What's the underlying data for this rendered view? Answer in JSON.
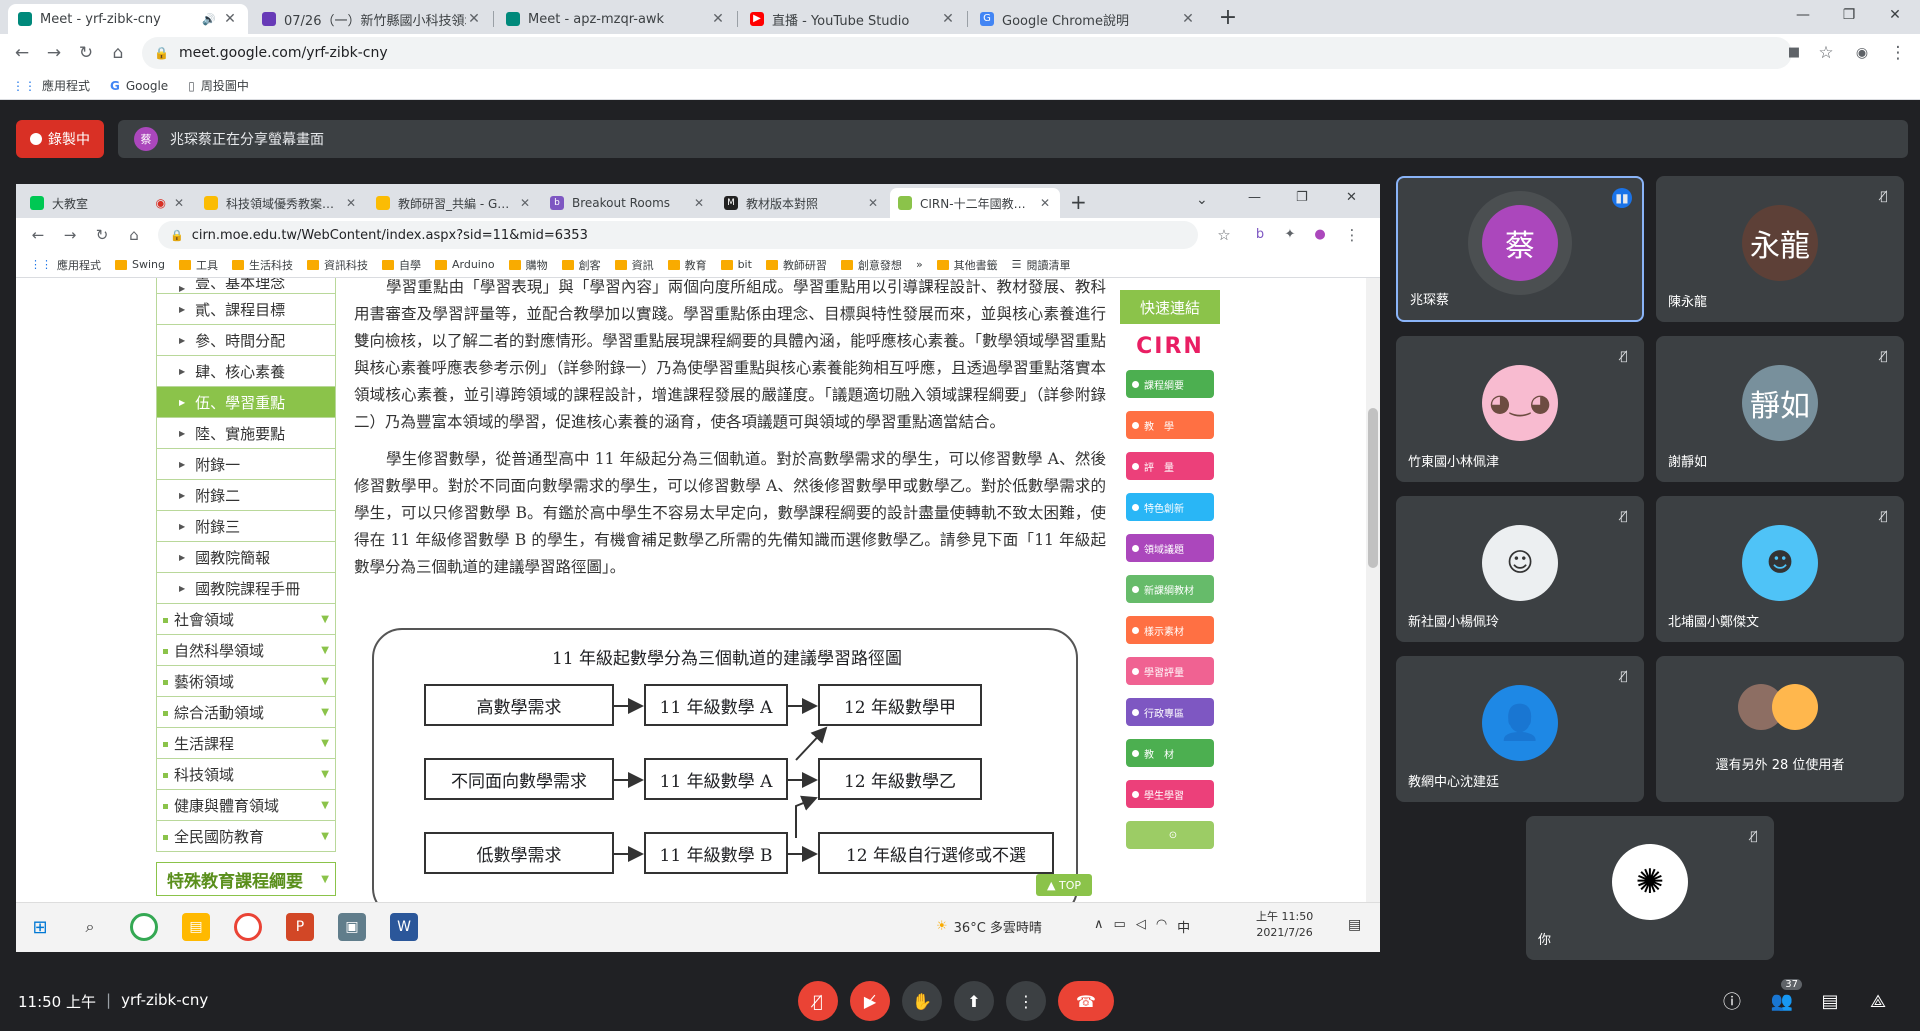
{
  "browser": {
    "tabs": [
      {
        "title": "Meet - yrf-zibk-cny",
        "color": "#00897b"
      },
      {
        "title": "07/26（一）新竹縣國小科技領域…",
        "color": "#673ab7"
      },
      {
        "title": "Meet - apz-mzqr-awk",
        "color": "#00897b"
      },
      {
        "title": "直播 - YouTube Studio",
        "color": "#ff0000"
      },
      {
        "title": "Google Chrome說明",
        "color": "#4285f4"
      }
    ],
    "url": "meet.google.com/yrf-zibk-cny",
    "bookmarks": [
      "應用程式",
      "Google",
      "周投圖中"
    ]
  },
  "meet": {
    "recording_label": "錄製中",
    "presenter_initial": "蔡",
    "presenting_text": "兆琛蔡正在分享螢幕畫面",
    "time": "11:50 上午",
    "meeting_code": "yrf-zibk-cny",
    "participant_count": "37"
  },
  "shared": {
    "tabs": [
      "大教室",
      "科技領域優秀教案…",
      "教師研習_共編 - G…",
      "Breakout Rooms",
      "教材版本對照",
      "CIRN-十二年國教…"
    ],
    "url": "cirn.moe.edu.tw/WebContent/index.aspx?sid=11&mid=6353",
    "bookmarks": [
      "應用程式",
      "Swing",
      "工具",
      "生活科技",
      "資訊科技",
      "自學",
      "Arduino",
      "購物",
      "創客",
      "資訊",
      "教育",
      "bit",
      "教師研習",
      "創意發想",
      "»",
      "其他書籤",
      "閱讀清單"
    ],
    "nav_items": [
      "壹、基本理念",
      "貳、課程目標",
      "參、時間分配",
      "肆、核心素養",
      "伍、學習重點",
      "陸、實施要點",
      "附錄一",
      "附錄二",
      "附錄三",
      "國教院簡報",
      "國教院課程手冊"
    ],
    "nav_categories": [
      "社會領域",
      "自然科學領域",
      "藝術領域",
      "綜合活動領域",
      "生活課程",
      "科技領域",
      "健康與體育領域",
      "全民國防教育"
    ],
    "nav_special": "特殊教育課程綱要",
    "para1": "學習重點由「學習表現」與「學習內容」兩個向度所組成。學習重點用以引導課程設計、教材發展、教科用書審查及學習評量等，並配合教學加以實踐。學習重點係由理念、目標與特性發展而來，並與核心素養進行雙向檢核，以了解二者的對應情形。學習重點展現課程綱要的具體內涵，能呼應核心素養。「數學領域學習重點與核心素養呼應表參考示例」（詳參附錄一）乃為使學習重點與核心素養能夠相互呼應，且透過學習重點落實本領域核心素養，並引導跨領域的課程設計，增進課程發展的嚴謹度。「議題適切融入領域課程綱要」（詳參附錄二）乃為豐富本領域的學習，促進核心素養的涵育，使各項議題可與領域的學習重點適當結合。",
    "para2": "學生修習數學，從普通型高中 11 年級起分為三個軌道。對於高數學需求的學生，可以修習數學 A、然後修習數學甲。對於不同面向數學需求的學生，可以修習數學 A、然後修習數學甲或數學乙。對於低數學需求的學生，可以只修習數學 B。有鑑於高中學生不容易太早定向，數學課程綱要的設計盡量使轉軌不致太困難，使得在 11 年級修習數學 B 的學生，有機會補足數學乙所需的先備知識而選修數學乙。請參見下面「11 年級起數學分為三個軌道的建議學習路徑圖」。",
    "flow_title": "11 年級起數學分為三個軌道的建議學習路徑圖",
    "flow_needs": [
      "高數學需求",
      "不同面向數學需求",
      "低數學需求"
    ],
    "flow_grade11": [
      "11 年級數學 A",
      "11 年級數學 A",
      "11 年級數學 B"
    ],
    "flow_grade12": [
      "12 年級數學甲",
      "12 年級數學乙",
      "12 年級自行選修或不選"
    ],
    "quick_title": "快速連結",
    "quick_logo": "CIRN",
    "quick_links": [
      "課程綱要",
      "教　學",
      "評　量",
      "特色創新",
      "領域議題",
      "新課綱教材",
      "樣示素材",
      "學習評量",
      "行政專區",
      "教　材",
      "學生學習"
    ],
    "top_label": "▲ TOP",
    "weather": "36°C 多雲時晴",
    "ime": "中",
    "sys_time": "上午 11:50",
    "sys_date": "2021/7/26"
  },
  "participants": [
    {
      "name": "兆琛蔡",
      "initial": "蔡",
      "color": "#ab47bc"
    },
    {
      "name": "陳永龍",
      "initial": "永龍",
      "color": "#5d4037"
    },
    {
      "name": "竹東國小林佩津",
      "initial": "",
      "color": "#f8bbd0"
    },
    {
      "name": "謝靜如",
      "initial": "靜如",
      "color": "#78909c"
    },
    {
      "name": "新社國小楊佩玲",
      "initial": "",
      "color": "#eceff1"
    },
    {
      "name": "北埔國小鄭傑文",
      "initial": "",
      "color": "#4fc3f7"
    },
    {
      "name": "教網中心沈建廷",
      "initial": "",
      "color": "#1e88e5"
    },
    {
      "name": "還有另外 28 位使用者",
      "initial": "",
      "color": "#607d8b"
    },
    {
      "name": "你",
      "initial": "",
      "color": "#ffffff"
    }
  ]
}
